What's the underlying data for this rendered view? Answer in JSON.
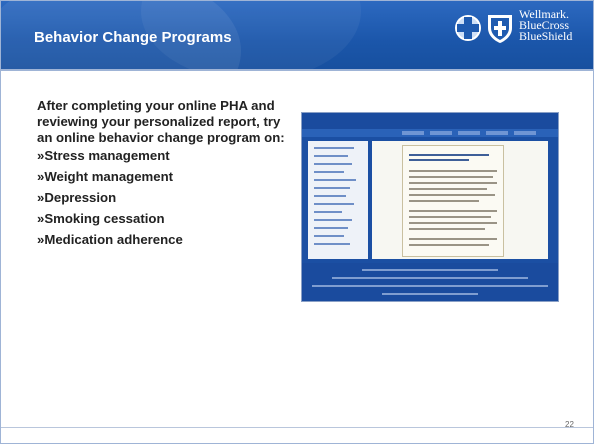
{
  "slide": {
    "title": "Behavior Change Programs",
    "intro": "After completing your online PHA and reviewing your personalized report, try an online behavior change program on:",
    "bullets": [
      "»Stress management",
      "»Weight management",
      "»Depression",
      "»Smoking cessation",
      "»Medication adherence"
    ],
    "page_number": "22"
  },
  "logo": {
    "brand_line1": "Wellmark.",
    "brand_line2": "BlueCross",
    "brand_line3": "BlueShield",
    "icons": [
      "blue-cross-icon",
      "blue-shield-icon"
    ]
  },
  "colors": {
    "header": "#1f5bb0",
    "text": "#222222",
    "accent": "#9fb4d6"
  }
}
